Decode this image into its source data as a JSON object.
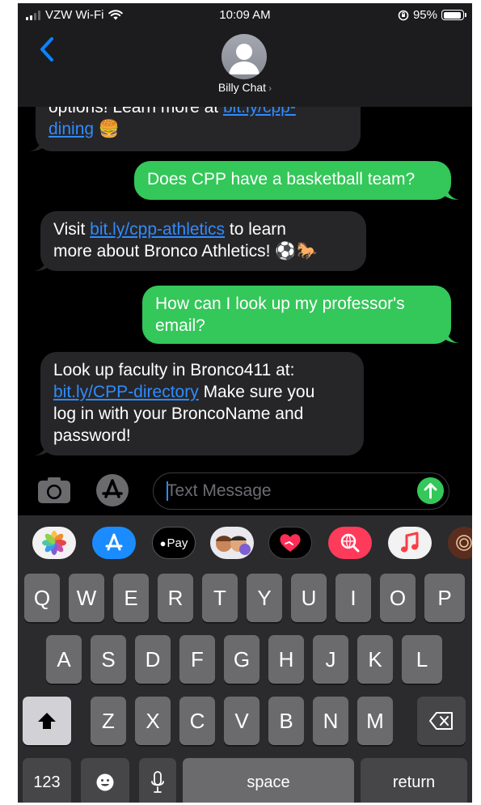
{
  "status_bar": {
    "carrier": "VZW Wi-Fi",
    "time": "10:09 AM",
    "battery": "95%",
    "battery_level": 0.95
  },
  "header": {
    "contact_name": "Billy Chat",
    "chevron": "›"
  },
  "messages": [
    {
      "direction": "incoming",
      "parts": [
        {
          "text": "options! Learn more at "
        },
        {
          "text": "bit.ly/cpp-dining",
          "link": true
        },
        {
          "text": " 🍔"
        }
      ]
    },
    {
      "direction": "outgoing",
      "text": "Does CPP have a basketball team?"
    },
    {
      "direction": "incoming",
      "parts": [
        {
          "text": "Visit "
        },
        {
          "text": "bit.ly/cpp-athletics",
          "link": true
        },
        {
          "text": " to learn more about Bronco Athletics! ⚽🐎"
        }
      ]
    },
    {
      "direction": "outgoing",
      "text": "How can I look up my professor's email?"
    },
    {
      "direction": "incoming",
      "parts": [
        {
          "text": "Look up faculty in Bronco411 at: "
        },
        {
          "text": "bit.ly/CPP-directory",
          "link": true
        },
        {
          "text": " Make sure you log in with your BroncoName and password!"
        }
      ]
    }
  ],
  "msg": {
    "m1_pre": "options! Learn more at",
    "m1_link_a": "bit.ly/cpp-",
    "m1_link_b": "dining",
    "m1_emoji": "🍔",
    "m2": "Does CPP have a basketball team?",
    "m3_pre": "Visit",
    "m3_link": "bit.ly/cpp-athletics",
    "m3_post": "to learn",
    "m3_line2": "more about Bronco Athletics! ⚽🐎",
    "m4_line1": "How can I look up my professor's",
    "m4_line2": "email?",
    "m5_line1": "Look up faculty in Bronco411 at:",
    "m5_link": "bit.ly/CPP-directory",
    "m5_post": "Make sure you",
    "m5_line3": "log in with your BroncoName and",
    "m5_line4": "password!"
  },
  "input": {
    "placeholder": "Text Message",
    "value": ""
  },
  "app_strip": {
    "items": [
      "photos-icon",
      "app-store-icon",
      "apple-pay-icon",
      "memoji-icon",
      "digital-touch-icon",
      "search-images-icon",
      "music-icon",
      "more-apps-icon"
    ],
    "apple_pay_label": "Pay"
  },
  "keyboard": {
    "row1": [
      "Q",
      "W",
      "E",
      "R",
      "T",
      "Y",
      "U",
      "I",
      "O",
      "P"
    ],
    "row2": [
      "A",
      "S",
      "D",
      "F",
      "G",
      "H",
      "J",
      "K",
      "L"
    ],
    "row3": [
      "Z",
      "X",
      "C",
      "V",
      "B",
      "N",
      "M"
    ],
    "numbers_label": "123",
    "space_label": "space",
    "return_label": "return"
  },
  "colors": {
    "outgoing_bubble": "#34c759",
    "incoming_bubble": "#262628",
    "link": "#2f8bff",
    "accent": "#0a84ff"
  }
}
